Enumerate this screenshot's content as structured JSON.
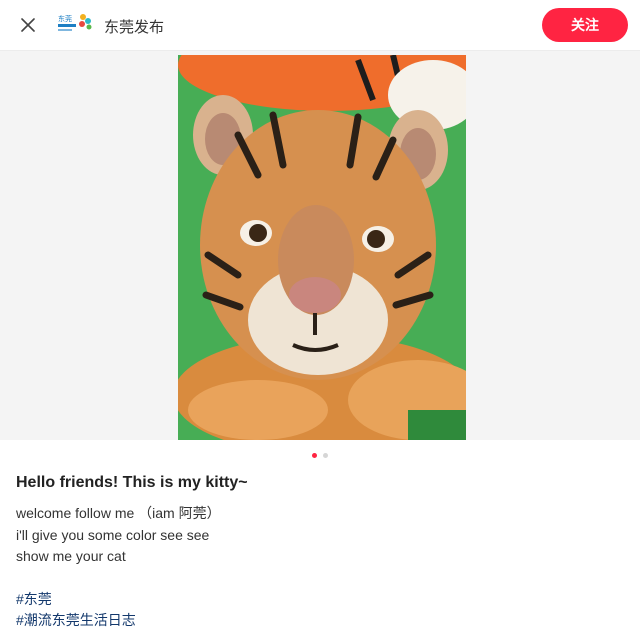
{
  "header": {
    "close_icon": "close-icon",
    "author_name": "东莞发布",
    "avatar_text": "东莞",
    "follow_label": "关注",
    "follow_color": "#ff2442"
  },
  "media": {
    "image_alt": "tiger cub",
    "carousel": {
      "count": 2,
      "active_index": 0
    }
  },
  "post": {
    "title": "Hello friends! This is my kitty~",
    "description_lines": [
      "welcome follow me （iam 阿莞）",
      "i'll give you some color see see",
      "show me your cat"
    ],
    "tags": [
      "#东莞",
      "#潮流东莞生活日志"
    ]
  }
}
